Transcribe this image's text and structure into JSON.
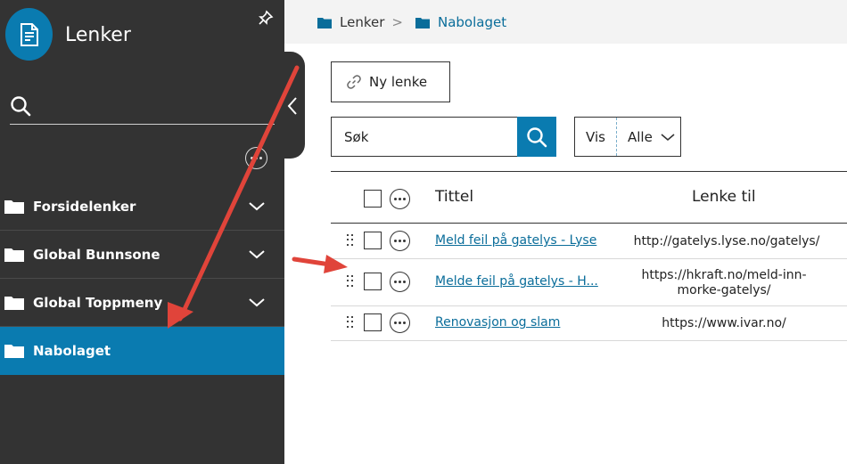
{
  "app": {
    "title": "Lenker",
    "logo_icon": "document-icon",
    "accent": "#0a7bb0"
  },
  "sidebar": {
    "folders": [
      {
        "label": "Forsidelenker",
        "expandable": true
      },
      {
        "label": "Global Bunnsone",
        "expandable": true
      },
      {
        "label": "Global Toppmeny",
        "expandable": true
      },
      {
        "label": "Nabolaget",
        "active": true
      }
    ]
  },
  "breadcrumb": [
    {
      "label": "Lenker"
    },
    {
      "label": "Nabolaget"
    }
  ],
  "toolbar": {
    "new_label": "Ny lenke",
    "search_placeholder": "Søk",
    "filter_label": "Vis",
    "filter_value": "Alle"
  },
  "table": {
    "headers": {
      "title": "Tittel",
      "link": "Lenke til"
    },
    "rows": [
      {
        "title": "Meld feil på gatelys - Lyse",
        "url": "http://gatelys.lyse.no/gatelys/"
      },
      {
        "title": "Melde feil på gatelys - H...",
        "url": "https://hkraft.no/meld-inn-\nmorke-gatelys/"
      },
      {
        "title": "Renovasjon og slam",
        "url": "https://www.ivar.no/"
      }
    ]
  },
  "annotation_color": "#e0443a"
}
